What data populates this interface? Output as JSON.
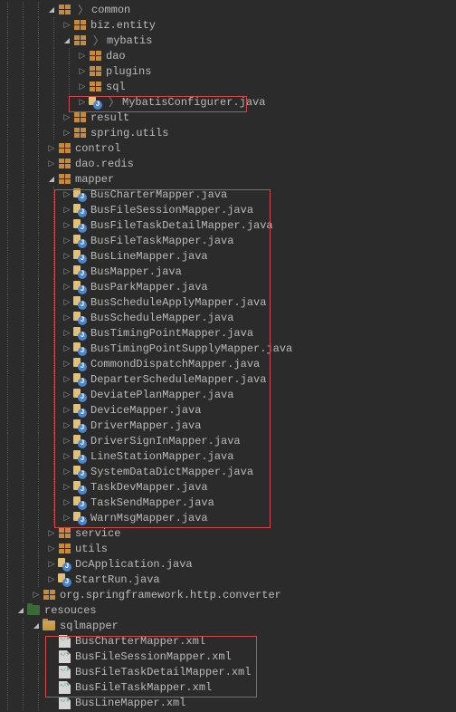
{
  "tree": {
    "common": "common",
    "biz_entity": "biz.entity",
    "mybatis": "mybatis",
    "mybatis_children": {
      "dao": "dao",
      "plugins": "plugins",
      "sql": "sql",
      "configurer": "MybatisConfigurer.java"
    },
    "result": "result",
    "spring_utils": "spring.utils",
    "control": "control",
    "dao_redis": "dao.redis",
    "mapper": "mapper",
    "mapper_files": [
      "BusCharterMapper.java",
      "BusFileSessionMapper.java",
      "BusFileTaskDetailMapper.java",
      "BusFileTaskMapper.java",
      "BusLineMapper.java",
      "BusMapper.java",
      "BusParkMapper.java",
      "BusScheduleApplyMapper.java",
      "BusScheduleMapper.java",
      "BusTimingPointMapper.java",
      "BusTimingPointSupplyMapper.java",
      "CommondDispatchMapper.java",
      "DeparterScheduleMapper.java",
      "DeviatePlanMapper.java",
      "DeviceMapper.java",
      "DriverMapper.java",
      "DriverSignInMapper.java",
      "LineStationMapper.java",
      "SystemDataDictMapper.java",
      "TaskDevMapper.java",
      "TaskSendMapper.java",
      "WarnMsgMapper.java"
    ],
    "service": "service",
    "utils": "utils",
    "dc_application": "DcApplication.java",
    "start_run": "StartRun.java",
    "spring_converter": "org.springframework.http.converter",
    "resouces": "resouces",
    "sqlmapper": "sqlmapper",
    "sqlmapper_files": [
      "BusCharterMapper.xml",
      "BusFileSessionMapper.xml",
      "BusFileTaskDetailMapper.xml",
      "BusFileTaskMapper.xml",
      "BusLineMapper.xml"
    ]
  }
}
